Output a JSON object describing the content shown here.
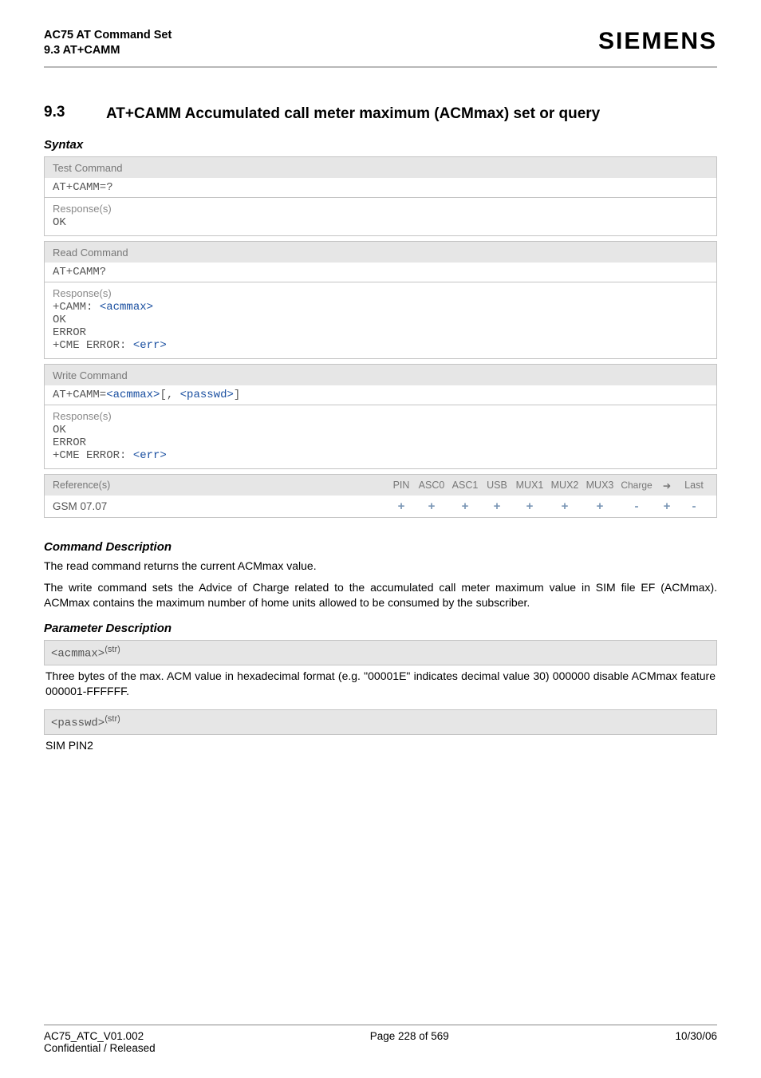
{
  "header": {
    "line1": "AC75 AT Command Set",
    "line2": "9.3 AT+CAMM",
    "brand": "SIEMENS"
  },
  "section": {
    "number": "9.3",
    "title": "AT+CAMM   Accumulated call meter maximum (ACMmax) set or query"
  },
  "syntax_label": "Syntax",
  "test_block": {
    "label": "Test Command",
    "cmd": "AT+CAMM=?",
    "resp_label": "Response(s)",
    "resp": "OK"
  },
  "read_block": {
    "label": "Read Command",
    "cmd": "AT+CAMM?",
    "resp_label": "Response(s)",
    "ln1a": "+CAMM: ",
    "ln1b": "<acmmax>",
    "ln2": "OK",
    "ln3": "ERROR",
    "ln4a": "+CME ERROR: ",
    "ln4b": "<err>"
  },
  "write_block": {
    "label": "Write Command",
    "cmd_a": "AT+CAMM=",
    "cmd_b": "<acmmax>",
    "cmd_c": "[, ",
    "cmd_d": "<passwd>",
    "cmd_e": "]",
    "resp_label": "Response(s)",
    "ln1": "OK",
    "ln2": "ERROR",
    "ln3a": "+CME ERROR: ",
    "ln3b": "<err>"
  },
  "ref": {
    "label": "Reference(s)",
    "cols": {
      "pin": "PIN",
      "asc0": "ASC0",
      "asc1": "ASC1",
      "usb": "USB",
      "mux1": "MUX1",
      "mux2": "MUX2",
      "mux3": "MUX3",
      "charge": "Charge",
      "arrow": "➜",
      "last": "Last"
    },
    "body_label": "GSM 07.07",
    "vals": {
      "pin": "+",
      "asc0": "+",
      "asc1": "+",
      "usb": "+",
      "mux1": "+",
      "mux2": "+",
      "mux3": "+",
      "charge": "-",
      "arrow": "+",
      "last": "-"
    }
  },
  "cmd_desc_head": "Command Description",
  "cmd_desc_p1": "The read command returns the current ACMmax value.",
  "cmd_desc_p2": "The write command sets the Advice of Charge related to the accumulated call meter maximum value in SIM file EF (ACMmax). ACMmax contains the maximum number of home units allowed to be consumed by the subscriber.",
  "param_desc_head": "Parameter Description",
  "param1": {
    "name": "<acmmax>",
    "sup": "(str)",
    "desc": "Three bytes of the max. ACM value in hexadecimal format (e.g. \"00001E\" indicates decimal value 30) 000000 disable ACMmax feature 000001-FFFFFF."
  },
  "param2": {
    "name": "<passwd>",
    "sup": "(str)",
    "desc": "SIM PIN2"
  },
  "footer": {
    "left": "AC75_ATC_V01.002",
    "center": "Page 228 of 569",
    "right": "10/30/06",
    "line2": "Confidential / Released"
  }
}
